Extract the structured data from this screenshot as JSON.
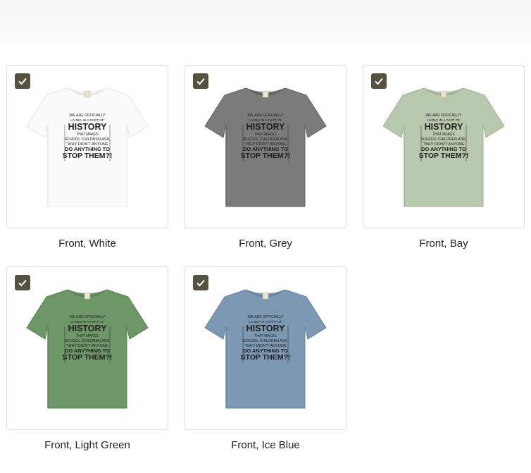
{
  "check_color": "#55533f",
  "variants": [
    {
      "caption": "Front, White",
      "shirt_color": "#fbfbfb",
      "shadow_color": "#e4e4e4",
      "ink": "#222222",
      "selected": true
    },
    {
      "caption": "Front, Grey",
      "shirt_color": "#7b7b7a",
      "shadow_color": "#636362",
      "ink": "#1e1e1e",
      "selected": true
    },
    {
      "caption": "Front, Bay",
      "shirt_color": "#b7c8ad",
      "shadow_color": "#9fb196",
      "ink": "#222222",
      "selected": true
    },
    {
      "caption": "Front, Light Green",
      "shirt_color": "#6e9768",
      "shadow_color": "#5b8156",
      "ink": "#1e1e1e",
      "selected": true
    },
    {
      "caption": "Front, Ice Blue",
      "shirt_color": "#7c98b3",
      "shadow_color": "#68839c",
      "ink": "#1e1e1e",
      "selected": true
    }
  ],
  "print": {
    "line1": "WE ARE OFFICIALLY",
    "line2": "LIVING IN A PART OF",
    "line3": "HISTORY",
    "line4": "THAT MAKES",
    "line5": "SCHOOL CHILDREN ASK,",
    "line6": "\"WHY DIDN'T ANYONE",
    "line7": "DO ANYTHING TO",
    "line8": "STOP THEM?!"
  }
}
